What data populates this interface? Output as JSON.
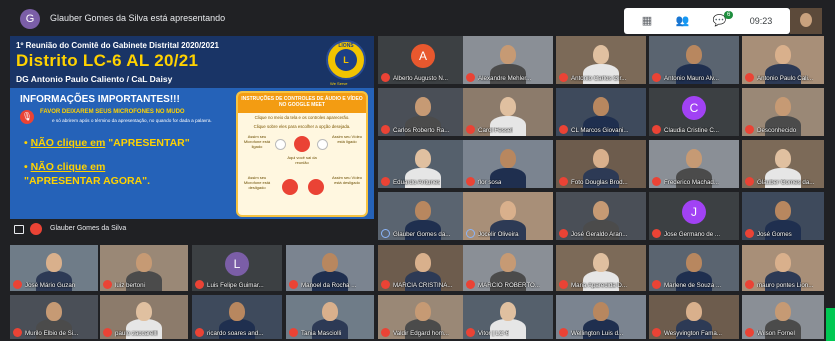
{
  "header": {
    "presenter_initial": "G",
    "presenter_text": "Glauber Gomes da Silva está apresentando",
    "badge_count": "6",
    "time": "09:23"
  },
  "slide": {
    "line1": "1º Reunião do Comitê do Gabinete Distrital 2020/2021",
    "title": "Distrito LC-6 AL 20/21",
    "line3": "DG Antonio Paulo Caliento / CaL Daisy",
    "logo_text": "LIONS",
    "logo_letter": "L",
    "logo_tagline": "We Serve",
    "info_title": "INFORMAÇÕES IMPORTANTES!!!",
    "mute_line1": "FAVOR DEIXAREM SEUS MICROFONES NO MUDO",
    "mute_line2": "e só abrirem após o término da apresentação, no quando for dada a palavra.",
    "bullet1_prefix": "• ",
    "bullet1_underlined": "NÃO clique em",
    "bullet1_rest": " \"APRESENTAR\"",
    "bullet2_prefix": "• ",
    "bullet2_underlined": "NÃO clique em",
    "bullet2_rest": "\"APRESENTAR AGORA\".",
    "instructions_title": "INSTRUÇÕES DE CONTROLES DE ÁUDIO E VÍDEO NO GOOGLE MEET",
    "instructions_sub1": "Clique no meio da tela e os controles aparecerão.",
    "instructions_sub2": "Clique sobre eles para escolher a opção desejada.",
    "ctl_mic_on": "Assim seu Microfone está ligado",
    "ctl_hangup": "Aqui você sai da reunião",
    "ctl_cam_on": "Assim seu Vídeo está ligado",
    "ctl_mic_off": "Assim seu Microfone está desligado",
    "ctl_cam_off": "Assim seu Vídeo está desligado",
    "footer_name": "Glauber Gomes da Silva"
  },
  "participants": [
    {
      "name": "Alberto Augusto N...",
      "initial": "A"
    },
    {
      "name": "Alexandre Mehler..."
    },
    {
      "name": "Antonio Carlos Gir..."
    },
    {
      "name": "Antonio Mauro Alv..."
    },
    {
      "name": "Antonio Paulo Cali..."
    },
    {
      "name": "Carlos Roberto Ra..."
    },
    {
      "name": "Carol Fessel"
    },
    {
      "name": "CL Marcos Giovani..."
    },
    {
      "name": "Claudia Cristine C...",
      "initial": "C"
    },
    {
      "name": "Desconhecido"
    },
    {
      "name": "Eduardo Antunes"
    },
    {
      "name": "flor sosa"
    },
    {
      "name": "Foto Douglas Brod..."
    },
    {
      "name": "Frederico Machad..."
    },
    {
      "name": "Glauber Gomes da..."
    },
    {
      "name": "Glauber Gomes da..."
    },
    {
      "name": "Jocelir Oliveira"
    },
    {
      "name": "José Geraldo Aran..."
    },
    {
      "name": "Jose Germano de ...",
      "initial": "J"
    },
    {
      "name": "José Gomes"
    },
    {
      "name": "José Mário Guzan"
    },
    {
      "name": "luiz bertoni"
    },
    {
      "name": "Luis Felipe Guimar...",
      "initial": "L"
    },
    {
      "name": "Manoel da Rocha ..."
    },
    {
      "name": "MARCIA CRISTINA..."
    },
    {
      "name": "MARCIO ROBERTO..."
    },
    {
      "name": "Maria Aparecida D..."
    },
    {
      "name": "Marlene de Souza ..."
    },
    {
      "name": "mauro pontes Lion..."
    },
    {
      "name": "Murilo Elbio de Si..."
    },
    {
      "name": "paulo zaccarelli"
    },
    {
      "name": "ricardo soares and..."
    },
    {
      "name": "Tania Masciolli"
    },
    {
      "name": "Valdir Edgard hom..."
    },
    {
      "name": "Vitor | LC-6"
    },
    {
      "name": "Wellington Luis d..."
    },
    {
      "name": "Wesyvington Fama..."
    },
    {
      "name": "Wilson Fornel"
    }
  ]
}
